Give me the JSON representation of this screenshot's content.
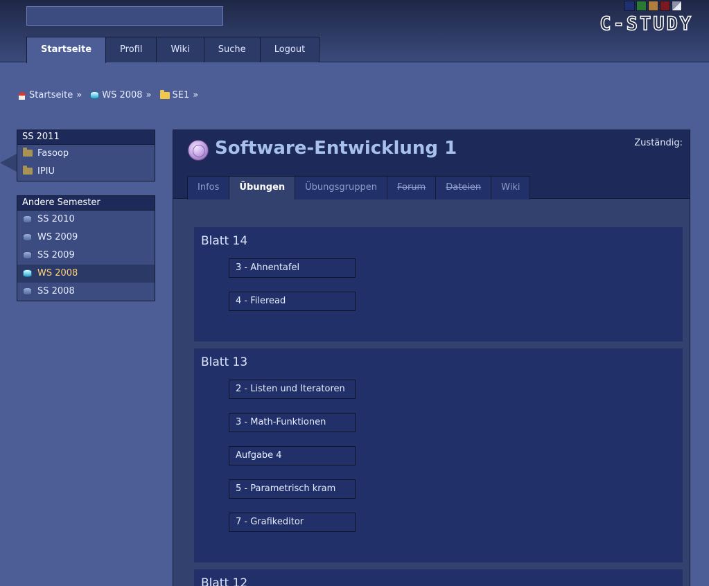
{
  "header": {
    "search": {
      "value": "",
      "placeholder": ""
    },
    "logo": "C-STUDY",
    "theme_swatches": [
      "#1f2f73",
      "#2a7a35",
      "#b07d3e",
      "#7a1a20",
      "split"
    ],
    "nav": [
      {
        "label": "Startseite",
        "active": true
      },
      {
        "label": "Profil"
      },
      {
        "label": "Wiki"
      },
      {
        "label": "Suche"
      },
      {
        "label": "Logout"
      }
    ]
  },
  "breadcrumb": [
    {
      "label": "Startseite",
      "icon": "home-icon"
    },
    {
      "label": "WS 2008",
      "icon": "disk-icon"
    },
    {
      "label": "SE1",
      "icon": "folder-icon"
    }
  ],
  "breadcrumb_separator": "»",
  "sidebar": {
    "current_semester": {
      "title": "SS 2011",
      "items": [
        {
          "label": "Fasoop",
          "icon": "folder-icon"
        },
        {
          "label": "IPIU",
          "icon": "folder-icon"
        }
      ]
    },
    "other_semesters": {
      "title": "Andere Semester",
      "items": [
        {
          "label": "SS 2010",
          "icon": "disk-icon"
        },
        {
          "label": "WS 2009",
          "icon": "disk-icon"
        },
        {
          "label": "SS 2009",
          "icon": "disk-icon"
        },
        {
          "label": "WS 2008",
          "icon": "disk-icon",
          "active": true
        },
        {
          "label": "SS 2008",
          "icon": "disk-icon"
        }
      ]
    }
  },
  "course": {
    "title": "Software-Entwicklung 1",
    "responsible_label": "Zuständig:",
    "tabs": [
      {
        "label": "Infos"
      },
      {
        "label": "Übungen",
        "active": true
      },
      {
        "label": "Übungsgruppen"
      },
      {
        "label": "Forum",
        "struck": true
      },
      {
        "label": "Dateien",
        "struck": true
      },
      {
        "label": "Wiki"
      }
    ],
    "sheets": [
      {
        "title": "Blatt 14",
        "exercises": [
          "3 - Ahnentafel",
          "4 - Fileread"
        ]
      },
      {
        "title": "Blatt 13",
        "exercises": [
          "2 - Listen und Iteratoren",
          "3 - Math-Funktionen",
          "Aufgabe 4",
          "5 - Parametrisch kram",
          "7 - Grafikeditor"
        ]
      },
      {
        "title": "Blatt 12",
        "exercises": []
      }
    ]
  }
}
